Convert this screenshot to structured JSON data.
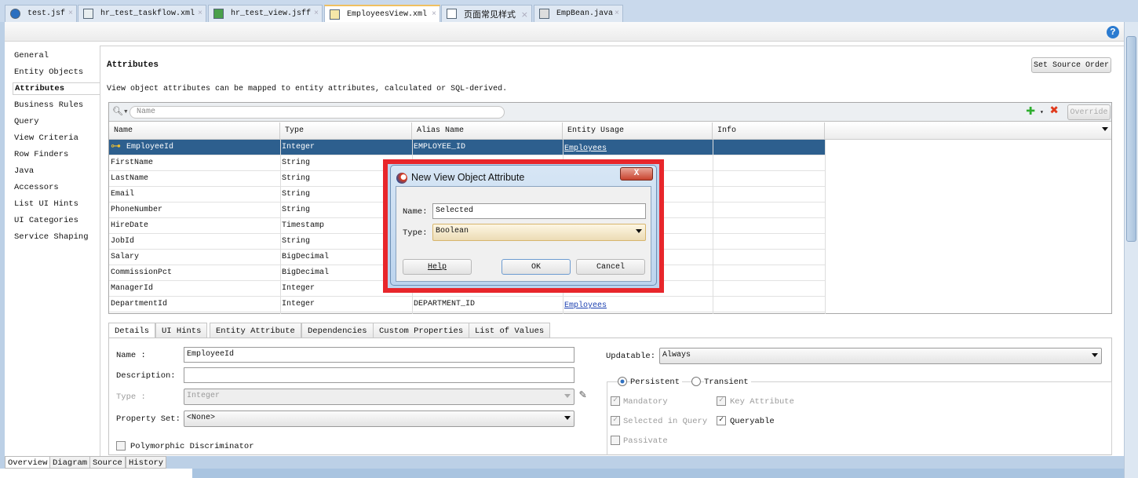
{
  "file_tabs": [
    {
      "label": "test.jsf",
      "icon": "globe-icon"
    },
    {
      "label": "hr_test_taskflow.xml",
      "icon": "taskflow-icon"
    },
    {
      "label": "hr_test_view.jsff",
      "icon": "jsff-icon"
    },
    {
      "label": "EmployeesView.xml",
      "icon": "view-object-icon",
      "active": true
    },
    {
      "label": "页面常见样式",
      "icon": "document-icon"
    },
    {
      "label": "EmpBean.java",
      "icon": "java-icon"
    }
  ],
  "help_label": "?",
  "nav": [
    "General",
    "Entity Objects",
    "Attributes",
    "Business Rules",
    "Query",
    "View Criteria",
    "Row Finders",
    "Java",
    "Accessors",
    "List UI Hints",
    "UI Categories",
    "Service Shaping"
  ],
  "nav_selected": "Attributes",
  "main": {
    "title": "Attributes",
    "description": "View object attributes can be mapped to entity attributes, calculated or SQL-derived.",
    "set_source_order": "Set Source Order",
    "search_placeholder": "Name",
    "override_label": "Override",
    "columns": [
      "Name",
      "Type",
      "Alias Name",
      "Entity Usage",
      "Info"
    ],
    "rows": [
      {
        "name": "EmployeeId",
        "type": "Integer",
        "alias": "EMPLOYEE_ID",
        "entity": "Employees",
        "key": true
      },
      {
        "name": "FirstName",
        "type": "String",
        "alias": "",
        "entity": ""
      },
      {
        "name": "LastName",
        "type": "String",
        "alias": "",
        "entity": ""
      },
      {
        "name": "Email",
        "type": "String",
        "alias": "",
        "entity": ""
      },
      {
        "name": "PhoneNumber",
        "type": "String",
        "alias": "",
        "entity": ""
      },
      {
        "name": "HireDate",
        "type": "Timestamp",
        "alias": "",
        "entity": ""
      },
      {
        "name": "JobId",
        "type": "String",
        "alias": "",
        "entity": ""
      },
      {
        "name": "Salary",
        "type": "BigDecimal",
        "alias": "",
        "entity": ""
      },
      {
        "name": "CommissionPct",
        "type": "BigDecimal",
        "alias": "",
        "entity": ""
      },
      {
        "name": "ManagerId",
        "type": "Integer",
        "alias": "",
        "entity": ""
      },
      {
        "name": "DepartmentId",
        "type": "Integer",
        "alias": "DEPARTMENT_ID",
        "entity": "Employees"
      }
    ]
  },
  "dialog": {
    "title": "New View Object Attribute",
    "close_label": "X",
    "name_label": "Name:",
    "name_value": "Selected",
    "type_label": "Type:",
    "type_value": "Boolean",
    "help": "Help",
    "ok": "OK",
    "cancel": "Cancel"
  },
  "detail_tabs": [
    "Details",
    "UI Hints",
    "Entity Attribute",
    "Dependencies",
    "Custom Properties",
    "List of Values"
  ],
  "details": {
    "name_label": "Name :",
    "name_value": "EmployeeId",
    "description_label": "Description:",
    "description_value": "",
    "type_label": "Type :",
    "type_value": "Integer",
    "property_set_label": "Property Set:",
    "property_set_value": "<None>",
    "polymorphic_label": "Polymorphic Discriminator",
    "updatable_label": "Updatable:",
    "updatable_value": "Always",
    "persistent_label": "Persistent",
    "transient_label": "Transient",
    "mandatory_label": "Mandatory",
    "key_attribute_label": "Key Attribute",
    "selected_in_query_label": "Selected in Query",
    "queryable_label": "Queryable",
    "passivate_label": "Passivate"
  },
  "bottom_tabs": [
    "Overview",
    "Diagram",
    "Source",
    "History"
  ],
  "colors": {
    "selection": "#2d5f8e",
    "highlight_border": "#e8262b",
    "add": "#2fae2f",
    "delete": "#e03a1c"
  }
}
